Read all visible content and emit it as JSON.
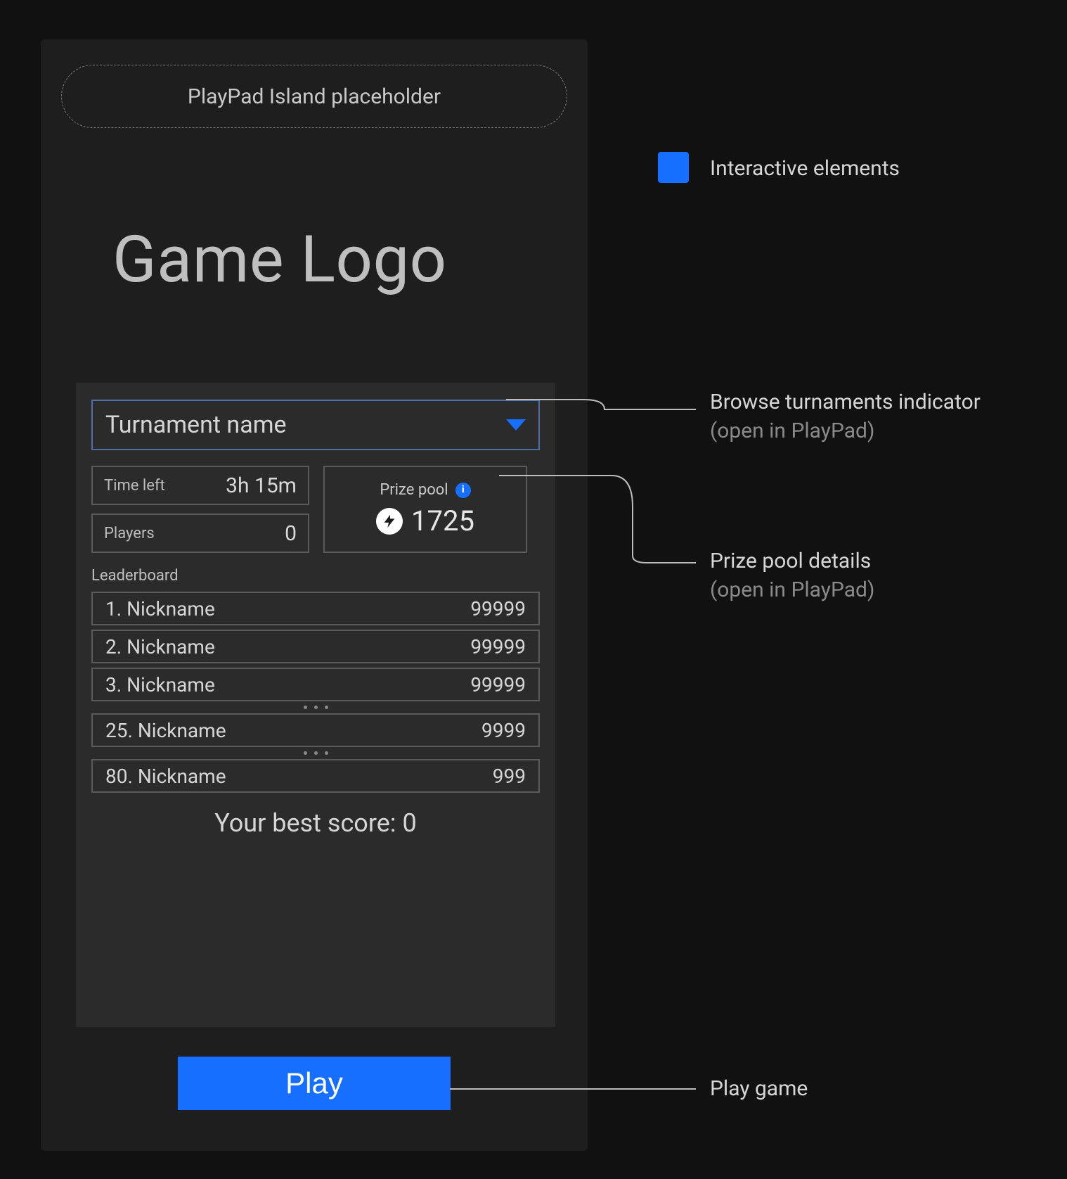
{
  "island_placeholder": "PlayPad Island placeholder",
  "game_logo": "Game Logo",
  "tournament": {
    "selector_label": "Turnament name",
    "time_left_label": "Time left",
    "time_left_value": "3h 15m",
    "players_label": "Players",
    "players_value": "0",
    "prize_pool_label": "Prize pool",
    "prize_pool_value": "1725",
    "leaderboard_title": "Leaderboard",
    "rows_top": [
      {
        "rank": "1.",
        "name": "Nickname",
        "score": "99999"
      },
      {
        "rank": "2.",
        "name": "Nickname",
        "score": "99999"
      },
      {
        "rank": "3.",
        "name": "Nickname",
        "score": "99999"
      }
    ],
    "row_mid": {
      "rank": "25.",
      "name": "Nickname",
      "score": "9999"
    },
    "row_last": {
      "rank": "80.",
      "name": "Nickname",
      "score": "999"
    },
    "best_score_label": "Your best score:",
    "best_score_value": "0"
  },
  "play_label": "Play",
  "legend_label": "Interactive elements",
  "annotations": {
    "browse_title": "Browse turnaments indicator",
    "browse_sub": "(open in PlayPad)",
    "prize_title": "Prize pool details",
    "prize_sub": "(open in PlayPad)",
    "play_title": "Play game"
  },
  "colors": {
    "accent": "#176fff",
    "panel": "#1e1e1e",
    "card": "#2b2b2b",
    "border": "#5a5a5a"
  }
}
